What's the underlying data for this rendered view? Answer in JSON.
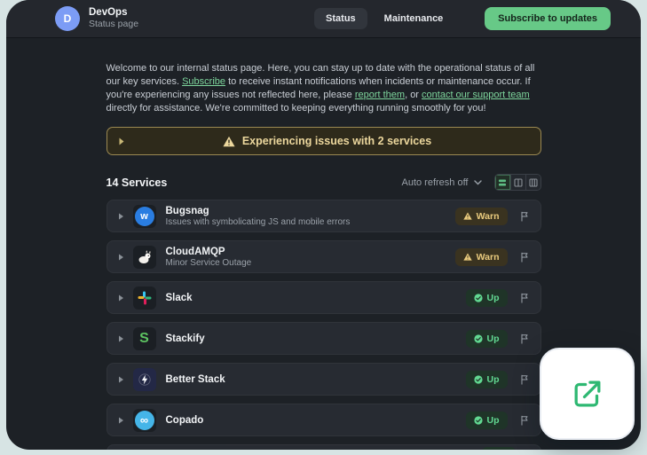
{
  "header": {
    "avatar_letter": "D",
    "title": "DevOps",
    "subtitle": "Status page",
    "nav": [
      {
        "label": "Status",
        "active": true
      },
      {
        "label": "Maintenance",
        "active": false
      }
    ],
    "subscribe_label": "Subscribe to updates"
  },
  "intro": {
    "segments": [
      {
        "text": "Welcome to our internal status page. Here, you can stay up to date with the operational status of all our key services. ",
        "link": false
      },
      {
        "text": "Subscribe",
        "link": true
      },
      {
        "text": " to receive instant notifications when incidents or maintenance occur. If you're experiencing any issues not reflected here, please ",
        "link": false
      },
      {
        "text": "report them",
        "link": true
      },
      {
        "text": ", or ",
        "link": false
      },
      {
        "text": "contact our support team",
        "link": true
      },
      {
        "text": " directly for assistance. We're committed to keeping everything running smoothly for you!",
        "link": false
      }
    ]
  },
  "banner": {
    "message": "Experiencing issues with 2 services"
  },
  "services_section": {
    "count_label": "14 Services",
    "auto_refresh_label": "Auto refresh off"
  },
  "services": [
    {
      "name": "Bugsnag",
      "subtitle": "Issues with symbolicating JS and mobile errors",
      "status": "Warn",
      "icon_letter": "w"
    },
    {
      "name": "CloudAMQP",
      "subtitle": "Minor Service Outage",
      "status": "Warn"
    },
    {
      "name": "Slack",
      "subtitle": "",
      "status": "Up"
    },
    {
      "name": "Stackify",
      "subtitle": "",
      "status": "Up",
      "icon_letter": "S"
    },
    {
      "name": "Better Stack",
      "subtitle": "",
      "status": "Up"
    },
    {
      "name": "Copado",
      "subtitle": "",
      "status": "Up",
      "icon_letter": "∞"
    }
  ],
  "icons": {
    "expand_caret": "caret-right",
    "warning": "warning-triangle",
    "flag": "report-flag",
    "check": "check-circle",
    "chevron_down": "chevron-down",
    "view_modes": [
      "list-view",
      "two-column-view",
      "three-column-view"
    ],
    "external_link": "arrow-out-of-box"
  },
  "colors": {
    "accent_green": "#67c987",
    "link_green": "#7ed69d",
    "warn_text": "#eacb7e",
    "warn_bg": "#3a3320",
    "up_text": "#62d992",
    "up_bg": "#1f3428",
    "banner_border": "#9b8952",
    "banner_text": "#ecd79d",
    "avatar_blue": "#7c9cf5",
    "page_bg": "#1d2126",
    "header_bg": "#24272d",
    "outer_bg": "#d7e4e4"
  }
}
